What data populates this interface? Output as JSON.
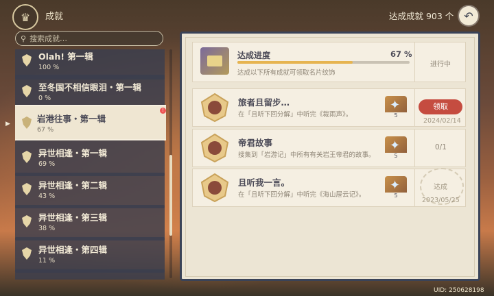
{
  "header": {
    "title": "成就",
    "count_label": "达成成就 903 个"
  },
  "search": {
    "placeholder": "搜索成就…"
  },
  "categories": [
    {
      "name": "Olah! 第一辑",
      "percent": "100 %"
    },
    {
      "name": "至冬国不相信眼泪・第一辑",
      "percent": "0 %"
    },
    {
      "name": "岩港往事・第一辑",
      "percent": "67 %",
      "selected": true
    },
    {
      "name": "异世相逢・第一辑",
      "percent": "69 %"
    },
    {
      "name": "异世相逢・第二辑",
      "percent": "43 %"
    },
    {
      "name": "异世相逢・第三辑",
      "percent": "38 %"
    },
    {
      "name": "异世相逢・第四辑",
      "percent": "11 %"
    }
  ],
  "progress": {
    "title": "达成进度",
    "percent": "67 %",
    "value": 0.67,
    "desc": "达成以下所有成就可领取名片纹饰",
    "status": "进行中"
  },
  "achievements": [
    {
      "name": "旅者且留步…",
      "desc": "在「且听下回分解」中听完《裁雨声》。",
      "reward": "5",
      "action": "领取",
      "date": "2024/02/14"
    },
    {
      "name": "帝君故事",
      "desc": "搜集到「岩游记」中所有有关岩王帝君的故事。",
      "reward": "5",
      "progress": "0/1"
    },
    {
      "name": "且听我一言。",
      "desc": "在「且听下回分解」中听完《海山屉云记》。",
      "reward": "5",
      "stamp": "达成",
      "date": "2023/05/25"
    }
  ],
  "uid": "UID: 250628198",
  "colors": {
    "accent": "#c54c40",
    "bar": "#e6b450",
    "panel": "#ece5d4"
  }
}
